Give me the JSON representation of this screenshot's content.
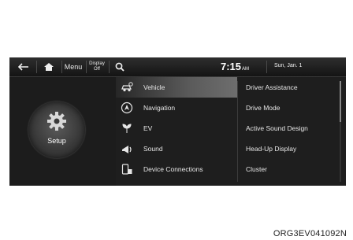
{
  "topbar": {
    "back_icon": "back-arrow-icon",
    "home_icon": "home-icon",
    "menu_label": "Menu",
    "display_off_line1": "Display",
    "display_off_line2": "Off",
    "search_icon": "search-icon",
    "time": "7:15",
    "ampm": "AM",
    "date": "Sun, Jan. 1"
  },
  "left_panel": {
    "label": "Setup",
    "icon": "gear-icon"
  },
  "menu": {
    "items": [
      {
        "label": "Vehicle",
        "icon": "vehicle-icon",
        "selected": true
      },
      {
        "label": "Navigation",
        "icon": "navigation-icon",
        "selected": false
      },
      {
        "label": "EV",
        "icon": "ev-plug-icon",
        "selected": false
      },
      {
        "label": "Sound",
        "icon": "sound-icon",
        "selected": false
      },
      {
        "label": "Device Connections",
        "icon": "device-connections-icon",
        "selected": false
      }
    ]
  },
  "submenu": {
    "items": [
      {
        "label": "Driver Assistance"
      },
      {
        "label": "Drive Mode"
      },
      {
        "label": "Active Sound Design"
      },
      {
        "label": "Head-Up Display"
      },
      {
        "label": "Cluster"
      }
    ]
  },
  "caption": "ORG3EV041092N",
  "colors": {
    "screen_bg": "#1e1e1e",
    "selected_bg": "#5a5a5a",
    "text": "#e6e6e6"
  }
}
